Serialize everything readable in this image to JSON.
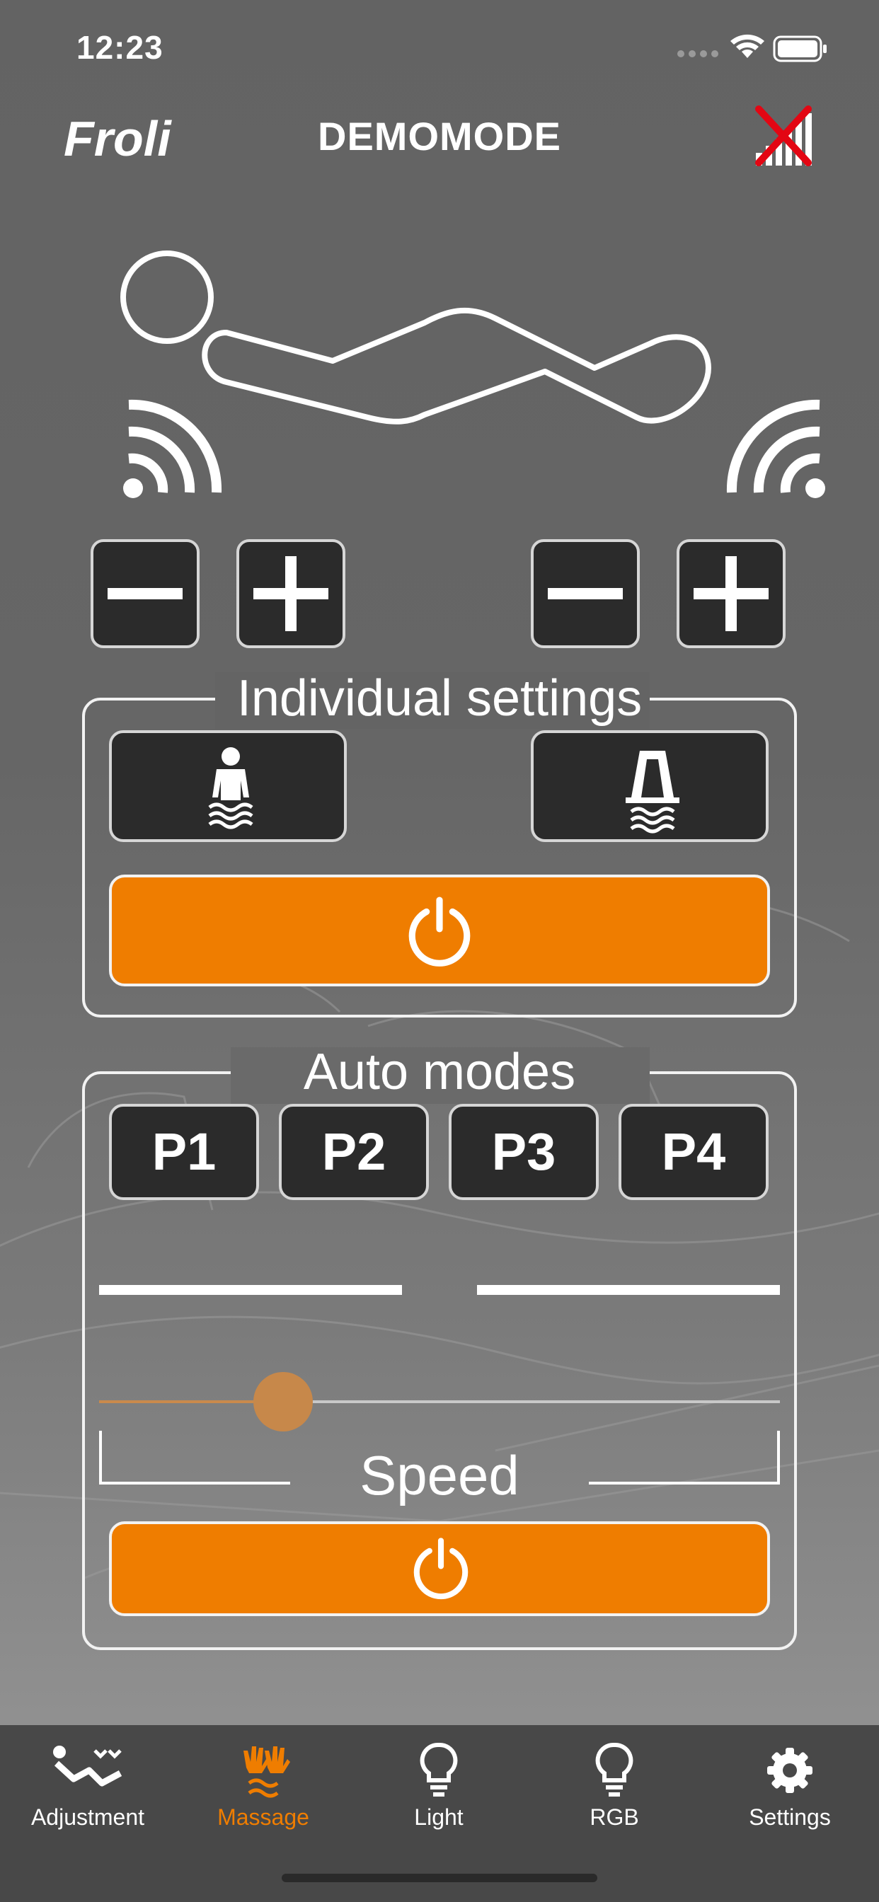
{
  "status_bar": {
    "time": "12:23"
  },
  "header": {
    "brand": "Froli",
    "title": "DEMOMODE"
  },
  "individual": {
    "title": "Individual settings"
  },
  "auto": {
    "title": "Auto modes",
    "presets": [
      "P1",
      "P2",
      "P3",
      "P4"
    ],
    "speed_label": "Speed",
    "speed_value_fraction": 0.27
  },
  "tabs": [
    {
      "label": "Adjustment",
      "icon": "adjustment-icon",
      "active": false
    },
    {
      "label": "Massage",
      "icon": "massage-icon",
      "active": true
    },
    {
      "label": "Light",
      "icon": "bulb-icon",
      "active": false
    },
    {
      "label": "RGB",
      "icon": "bulb-icon",
      "active": false
    },
    {
      "label": "Settings",
      "icon": "gear-icon",
      "active": false
    }
  ],
  "colors": {
    "accent": "#ef7d00",
    "button_dark": "#2b2b2b",
    "background": "#666666",
    "tab_bar": "#484848",
    "disconnect_red": "#e30613"
  }
}
